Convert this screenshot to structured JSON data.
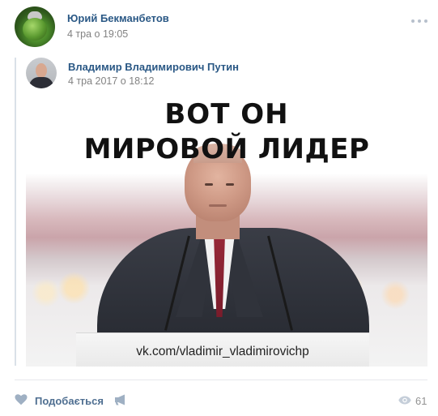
{
  "post": {
    "author": "Юрий Бекманбетов",
    "date": "4 тра о 19:05",
    "repost": {
      "author": "Владимир Владимирович Путин",
      "date": "4 тра 2017 о 18:12",
      "image": {
        "caption_line1": "ВОТ ОН",
        "caption_line2": "МИРОВОЙ ЛИДЕР",
        "podium_text": "vk.com/vladimir_vladimirovichp"
      }
    }
  },
  "actions": {
    "like_label": "Подобається",
    "views_count": "61"
  },
  "icons": {
    "like": "heart-icon",
    "share": "megaphone-icon",
    "views": "eye-icon",
    "more": "more-dots-icon"
  },
  "colors": {
    "link": "#2a5885",
    "meta": "#828282",
    "action": "#4f6f91",
    "icon": "#9fb0c3"
  }
}
